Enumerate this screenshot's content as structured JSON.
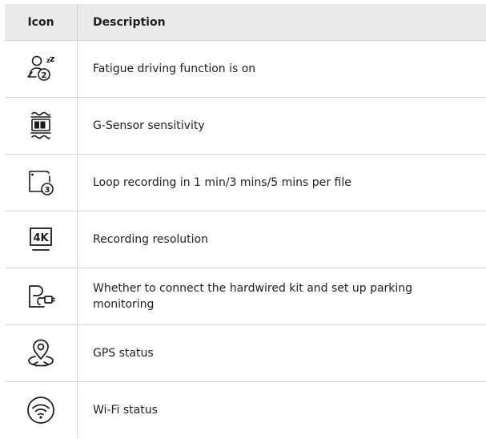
{
  "table": {
    "headers": {
      "icon": "Icon",
      "description": "Description"
    },
    "rows": [
      {
        "icon": "fatigue-driving-icon",
        "description": "Fatigue driving function is on"
      },
      {
        "icon": "g-sensor-icon",
        "description": "G-Sensor sensitivity"
      },
      {
        "icon": "loop-recording-icon",
        "description": "Loop recording in 1 min/3 mins/5 mins per file"
      },
      {
        "icon": "resolution-4k-icon",
        "icon_text": "4K",
        "description": "Recording resolution"
      },
      {
        "icon": "parking-monitor-icon",
        "description": "Whether to connect the hardwired kit and set up parking monitoring"
      },
      {
        "icon": "gps-status-icon",
        "description": "GPS status"
      },
      {
        "icon": "wifi-status-icon",
        "description": "Wi-Fi status"
      }
    ]
  },
  "colors": {
    "header_bg": "#eaeaea",
    "border": "#d6d6d6",
    "text": "#1f1f1f",
    "icon": "#1a1a1a"
  }
}
